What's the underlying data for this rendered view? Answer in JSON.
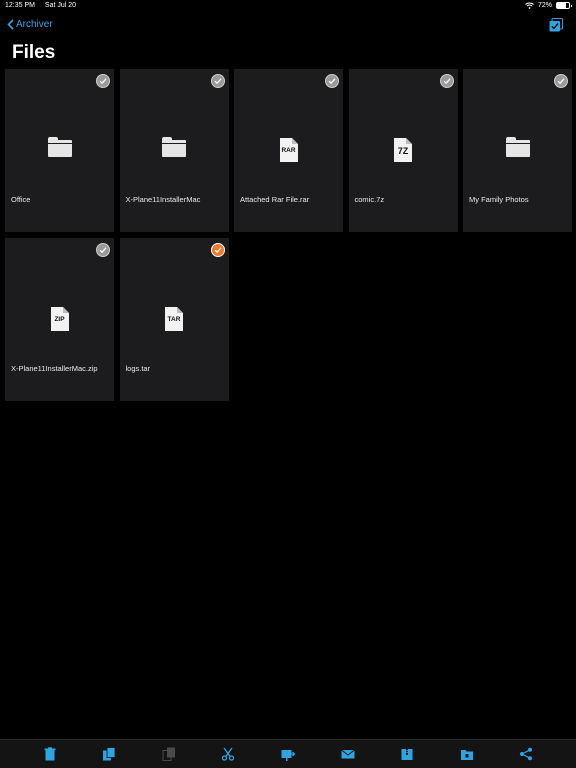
{
  "status_bar": {
    "time": "12:35 PM",
    "date": "Sat Jul 20",
    "battery": "72%",
    "battery_level": 0.72
  },
  "nav": {
    "back_label": "Archiver"
  },
  "page": {
    "title": "Files"
  },
  "files": [
    {
      "name": "Office",
      "kind": "folder",
      "selected": false
    },
    {
      "name": "X-Plane11InstallerMac",
      "kind": "folder",
      "selected": false
    },
    {
      "name": "Attached Rar File.rar",
      "kind": "archive",
      "ext": "RAR",
      "selected": false
    },
    {
      "name": "comic.7z",
      "kind": "archive",
      "ext": "7Z",
      "selected": false
    },
    {
      "name": "My Family Photos",
      "kind": "folder",
      "selected": false
    },
    {
      "name": "X-Plane11InstallerMac.zip",
      "kind": "archive",
      "ext": "ZIP",
      "selected": false
    },
    {
      "name": "logs.tar",
      "kind": "archive",
      "ext": "TAR",
      "selected": true
    }
  ],
  "toolbar": [
    "trash-icon",
    "copy-icon",
    "paste-icon",
    "scissors-icon",
    "move-icon",
    "mail-icon",
    "archive-icon",
    "extract-icon",
    "share-icon"
  ],
  "colors": {
    "accent": "#2fa4e2",
    "selected": "#f07a2a",
    "tile": "#1c1c1e",
    "background": "#000000"
  }
}
